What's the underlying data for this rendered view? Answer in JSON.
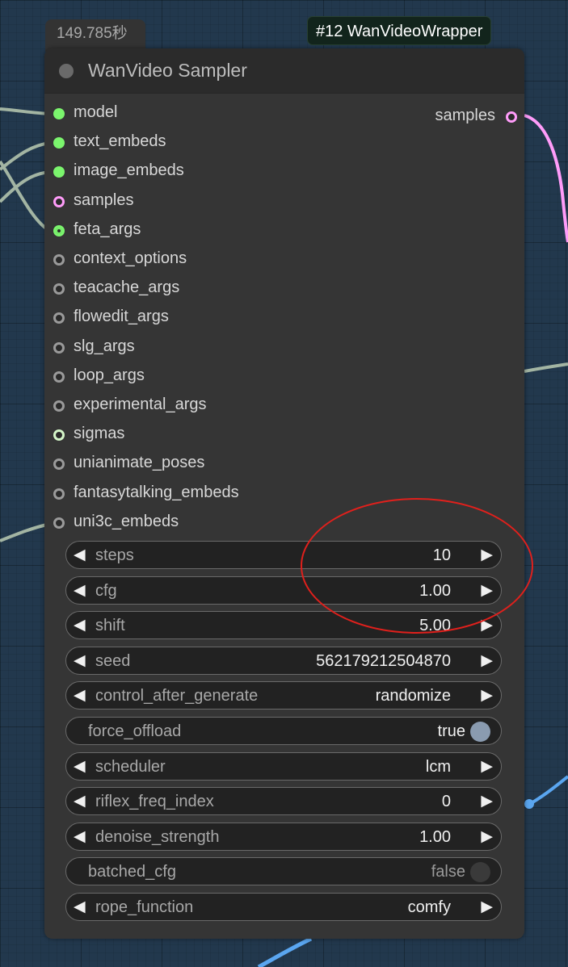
{
  "timer": "149.785秒",
  "badge": "#12 WanVideoWrapper",
  "node": {
    "title": "WanVideo Sampler",
    "output": {
      "label": "samples",
      "color": "#ff9cf9"
    },
    "inputs": [
      {
        "label": "model",
        "state": "connected",
        "color": "#7bf56d"
      },
      {
        "label": "text_embeds",
        "state": "connected",
        "color": "#7bf56d"
      },
      {
        "label": "image_embeds",
        "state": "connected",
        "color": "#7bf56d"
      },
      {
        "label": "samples",
        "state": "optional",
        "color": "#ff9cf9"
      },
      {
        "label": "feta_args",
        "state": "connected-optional",
        "color": "#7bf56d"
      },
      {
        "label": "context_options",
        "state": "optional",
        "color": "#9a9a9a"
      },
      {
        "label": "teacache_args",
        "state": "optional",
        "color": "#9a9a9a"
      },
      {
        "label": "flowedit_args",
        "state": "optional",
        "color": "#9a9a9a"
      },
      {
        "label": "slg_args",
        "state": "optional",
        "color": "#9a9a9a"
      },
      {
        "label": "loop_args",
        "state": "optional",
        "color": "#9a9a9a"
      },
      {
        "label": "experimental_args",
        "state": "optional",
        "color": "#9a9a9a"
      },
      {
        "label": "sigmas",
        "state": "optional",
        "color": "#d4f5c8"
      },
      {
        "label": "unianimate_poses",
        "state": "optional",
        "color": "#9a9a9a"
      },
      {
        "label": "fantasytalking_embeds",
        "state": "optional",
        "color": "#9a9a9a"
      },
      {
        "label": "uni3c_embeds",
        "state": "optional",
        "color": "#9a9a9a"
      }
    ],
    "widgets": [
      {
        "kind": "number",
        "label": "steps",
        "value": "10"
      },
      {
        "kind": "number",
        "label": "cfg",
        "value": "1.00"
      },
      {
        "kind": "number",
        "label": "shift",
        "value": "5.00"
      },
      {
        "kind": "number",
        "label": "seed",
        "value": "562179212504870"
      },
      {
        "kind": "combo",
        "label": "control_after_generate",
        "value": "randomize"
      },
      {
        "kind": "toggle",
        "label": "force_offload",
        "value": "true"
      },
      {
        "kind": "combo",
        "label": "scheduler",
        "value": "lcm"
      },
      {
        "kind": "number",
        "label": "riflex_freq_index",
        "value": "0"
      },
      {
        "kind": "number",
        "label": "denoise_strength",
        "value": "1.00"
      },
      {
        "kind": "toggle",
        "label": "batched_cfg",
        "value": "false"
      },
      {
        "kind": "combo",
        "label": "rope_function",
        "value": "comfy"
      }
    ],
    "arrow_left": "◀",
    "arrow_right": "▶"
  },
  "colors": {
    "canvas": "#22384d",
    "node_body": "#353535",
    "wire_model": "#a3b5a3",
    "wire_samples": "#ff9cf9",
    "wire_blue": "#5aa6f0",
    "annotation": "#e0201c"
  }
}
